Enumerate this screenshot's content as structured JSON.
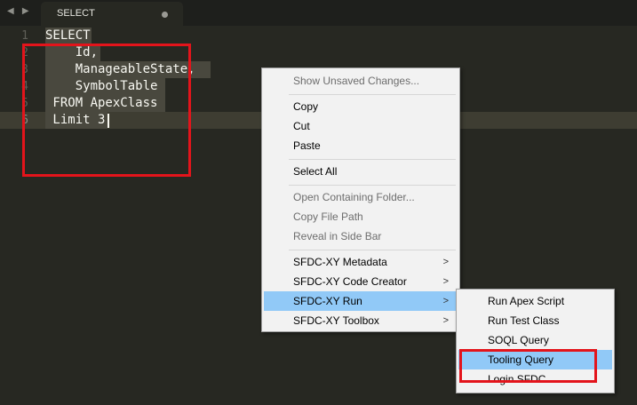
{
  "tab": {
    "title": "SELECT"
  },
  "editor": {
    "line_numbers": [
      "1",
      "2",
      "3",
      "4",
      "5",
      "6"
    ],
    "lines": [
      "SELECT",
      "    Id,",
      "    ManageableState,",
      "    SymbolTable",
      " FROM ApexClass",
      " Limit 3"
    ]
  },
  "context_menu": {
    "show_unsaved": "Show Unsaved Changes...",
    "copy": "Copy",
    "cut": "Cut",
    "paste": "Paste",
    "select_all": "Select All",
    "open_folder": "Open Containing Folder...",
    "copy_path": "Copy File Path",
    "reveal": "Reveal in Side Bar",
    "sfdc_metadata": "SFDC-XY Metadata",
    "sfdc_code_creator": "SFDC-XY Code Creator",
    "sfdc_run": "SFDC-XY Run",
    "sfdc_toolbox": "SFDC-XY Toolbox"
  },
  "submenu": {
    "run_apex": "Run Apex Script",
    "run_test": "Run Test Class",
    "soql_query": "SOQL Query",
    "tooling_query": "Tooling Query",
    "login": "Login SFDC"
  },
  "colors": {
    "highlight_border": "#e3141b",
    "menu_active": "#91c9f7"
  }
}
